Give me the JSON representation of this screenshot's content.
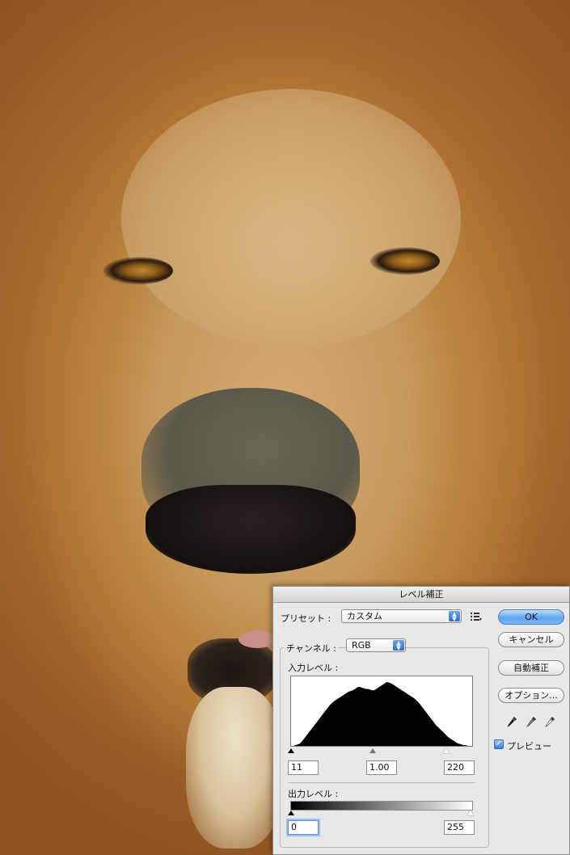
{
  "dialog": {
    "title": "レベル補正",
    "preset_label": "プリセット :",
    "preset_value": "カスタム",
    "channel_label": "チャンネル :",
    "channel_value": "RGB",
    "input_levels_label": "入力レベル :",
    "input_values": {
      "black": "11",
      "gamma": "1.00",
      "white": "220"
    },
    "output_levels_label": "出力レベル :",
    "output_values": {
      "black": "0",
      "white": "255"
    },
    "buttons": {
      "ok": "OK",
      "cancel": "キャンセル",
      "auto": "自動補正",
      "options": "オプション..."
    },
    "preview_label": "プレビュー",
    "preview_checked": true,
    "accent_color": "#3d7fe0"
  },
  "histogram": {
    "bins": [
      0,
      0,
      1,
      2,
      3,
      6,
      10,
      14,
      18,
      22,
      26,
      30,
      34,
      38,
      42,
      46,
      50,
      54,
      58,
      61,
      64,
      66,
      68,
      70,
      72,
      74,
      76,
      78,
      79,
      80,
      82,
      84,
      85,
      84,
      83,
      82,
      82,
      81,
      80,
      80,
      82,
      84,
      86,
      88,
      90,
      92,
      91,
      90,
      88,
      86,
      84,
      82,
      80,
      78,
      76,
      74,
      72,
      70,
      68,
      65,
      62,
      58,
      54,
      50,
      46,
      42,
      38,
      34,
      30,
      27,
      24,
      21,
      18,
      15,
      12,
      10,
      8,
      6,
      4,
      3,
      2,
      1,
      1,
      0,
      0,
      0
    ]
  }
}
